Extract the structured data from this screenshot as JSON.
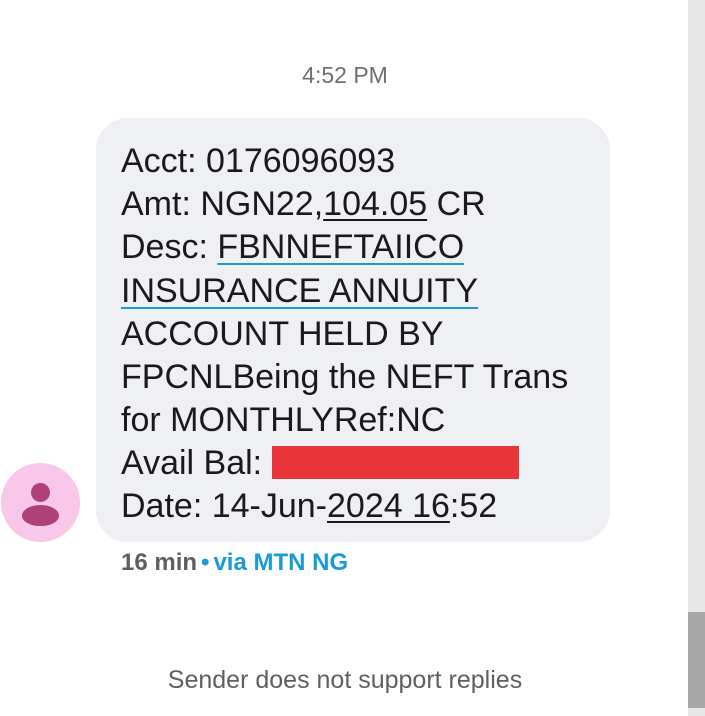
{
  "conversation": {
    "timestamp": "4:52 PM",
    "message": {
      "line1_label": "Acct: ",
      "line1_value": "0176096093",
      "line2_prefix": "Amt: NGN22,",
      "line2_link": "104.05",
      "line2_suffix": " CR",
      "line3_label": "Desc: ",
      "line3_link": "FBNNEFTAIICO ",
      "line4_link": "INSURANCE ANNUITY",
      "line5": "ACCOUNT HELD BY",
      "line6": "FPCNLBeing the NEFT Trans",
      "line7": "for MONTHLYRef:NC",
      "line8_label": "Avail Bal: ",
      "line9_prefix": "Date: 14-Jun-",
      "line9_link": "2024 16",
      "line9_suffix": ":52"
    },
    "meta": {
      "time_ago": "16 min",
      "separator": "•",
      "carrier": "via MTN NG"
    },
    "footer": {
      "reply_status": "Sender does not support replies"
    },
    "avatar": {
      "icon": "person-icon"
    }
  }
}
